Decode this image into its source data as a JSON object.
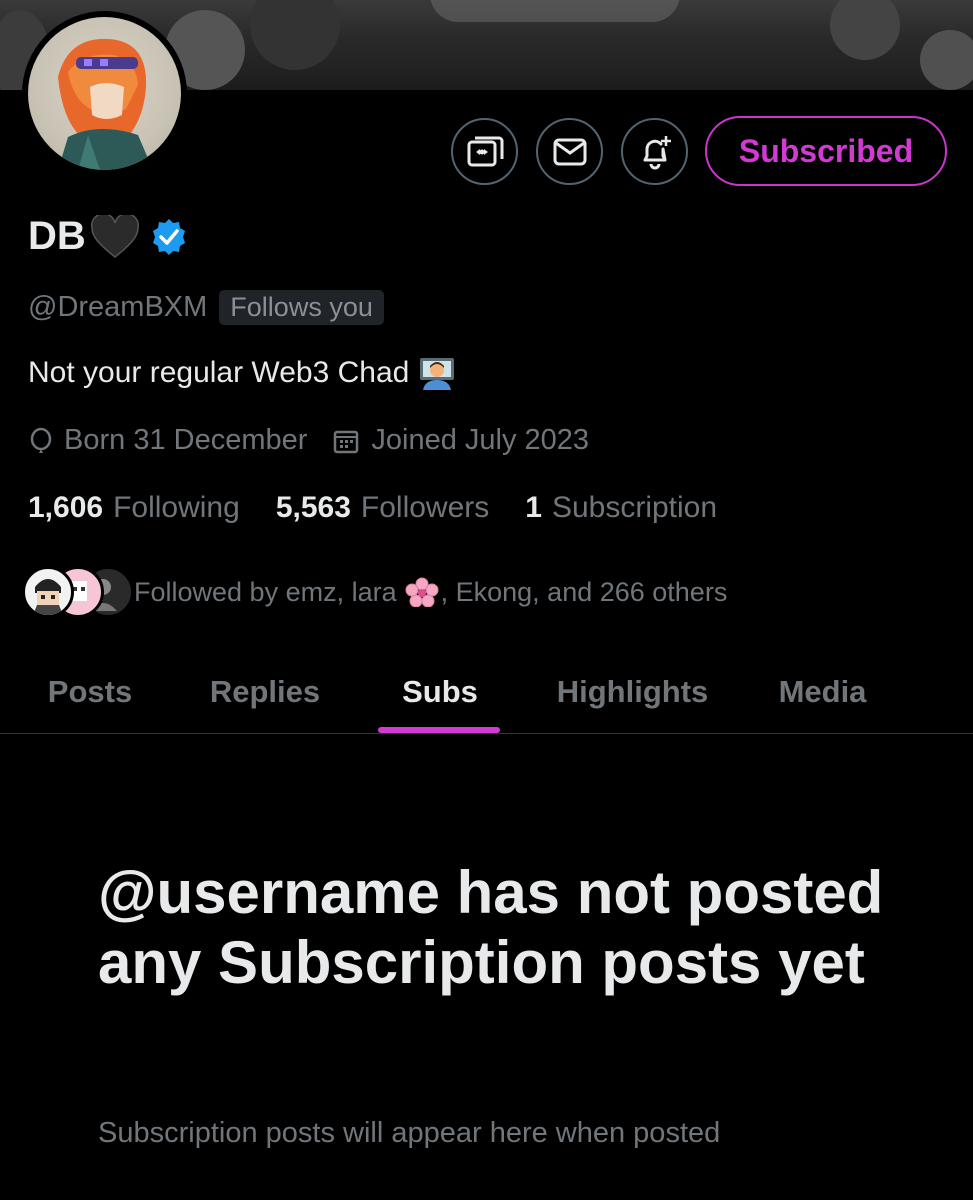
{
  "profile": {
    "display_name": "DB",
    "handle": "@DreamBXM",
    "follows_you": "Follows you",
    "bio": "Not your regular Web3 Chad",
    "location": "Born 31 December",
    "joined": "Joined July 2023",
    "verified": true
  },
  "actions": {
    "subscribed_label": "Subscribed",
    "icons": [
      "subscription-icon",
      "message-icon",
      "notification-bell-icon"
    ]
  },
  "stats": {
    "following_count": "1,606",
    "following_label": "Following",
    "followers_count": "5,563",
    "followers_label": "Followers",
    "subscription_count": "1",
    "subscription_label": "Subscription"
  },
  "followed_by": {
    "prefix": "Followed by emz, lara",
    "suffix": ", Ekong, and 266 others"
  },
  "tabs": [
    {
      "label": "Posts"
    },
    {
      "label": "Replies"
    },
    {
      "label": "Subs"
    },
    {
      "label": "Highlights"
    },
    {
      "label": "Media"
    }
  ],
  "active_tab": "Subs",
  "empty_state": {
    "title": "@username has not posted any Subscription posts yet",
    "subtitle": "Subscription posts will appear here when posted"
  },
  "colors": {
    "accent": "#d33ad3",
    "background": "#000000",
    "text_primary": "#e7e9ea",
    "text_secondary": "#71767b",
    "verified": "#1d9bf0"
  }
}
